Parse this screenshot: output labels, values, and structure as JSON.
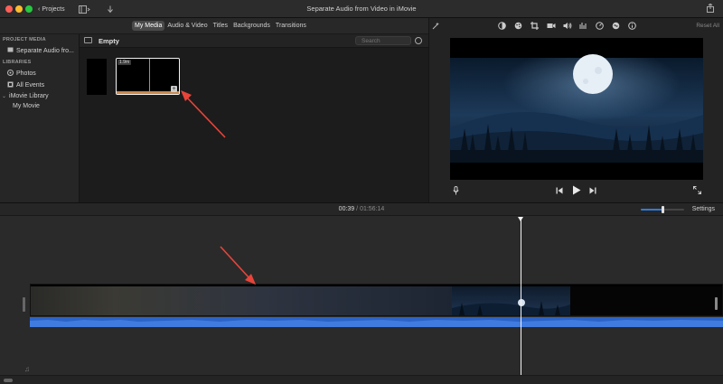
{
  "window": {
    "title": "Separate Audio from Video in iMovie",
    "projects_label": "Projects"
  },
  "icons": {
    "traffic_lights": [
      "close-icon",
      "minimize-icon",
      "zoom-icon"
    ],
    "toolbar": [
      "media-view-icon",
      "import-icon",
      "share-icon"
    ],
    "viewer_tools": [
      "magic-wand-icon",
      "color-balance-icon",
      "color-correction-icon",
      "crop-icon",
      "stabilization-icon",
      "volume-icon",
      "equalizer-icon",
      "speed-icon",
      "noise-reduction-icon",
      "info-icon"
    ],
    "player": [
      "microphone-icon",
      "skip-back-icon",
      "play-icon",
      "skip-forward-icon",
      "fullscreen-icon"
    ]
  },
  "browser_tabs": [
    {
      "label": "My Media",
      "active": true
    },
    {
      "label": "Audio & Video",
      "active": false
    },
    {
      "label": "Titles",
      "active": false
    },
    {
      "label": "Backgrounds",
      "active": false
    },
    {
      "label": "Transitions",
      "active": false
    }
  ],
  "sidebar": {
    "project_media_header": "PROJECT MEDIA",
    "project_item": "Separate Audio fro...",
    "libraries_header": "LIBRARIES",
    "items": [
      {
        "label": "Photos",
        "icon": "photos-icon"
      },
      {
        "label": "All Events",
        "icon": "events-icon"
      }
    ],
    "library": "iMovie Library",
    "library_child": "My Movie"
  },
  "browser": {
    "event_title": "Empty",
    "search_placeholder": "Search",
    "clip_duration": "1.9m"
  },
  "viewer": {
    "reset_all": "Reset All"
  },
  "timeline": {
    "current_time": "00:39",
    "separator": "/",
    "total_time": "01:56:14",
    "settings_label": "Settings",
    "zoom_level": 0.5
  },
  "colors": {
    "audio_track": "#2b63c9",
    "annotation_arrow": "#e8443a",
    "clip_border": "#f2f2f2"
  }
}
